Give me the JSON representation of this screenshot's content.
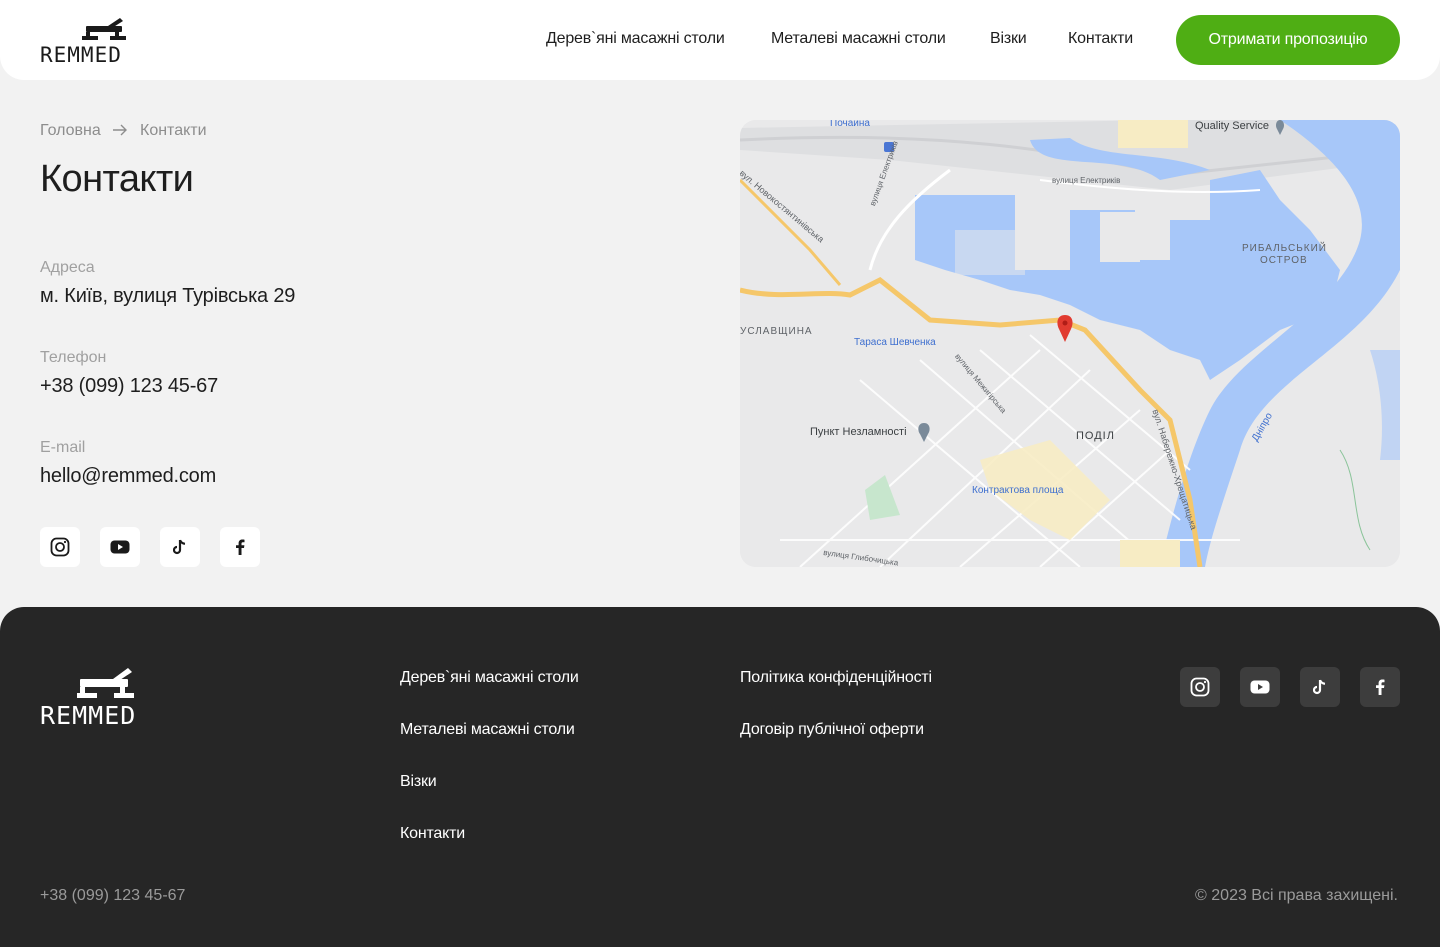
{
  "header": {
    "logo_text": "REMMED",
    "nav": [
      "Дерев`яні масажні столи",
      "Металеві масажні столи",
      "Візки",
      "Контакти"
    ],
    "cta": "Отримати пропозицію"
  },
  "breadcrumb": {
    "home": "Головна",
    "current": "Контакти"
  },
  "page_title": "Контакти",
  "contacts": {
    "address_label": "Адреса",
    "address": "м. Київ, вулиця Турівська 29",
    "phone_label": "Телефон",
    "phone": "+38 (099) 123 45-67",
    "email_label": "E-mail",
    "email": "hello@remmed.com"
  },
  "socials": [
    "instagram-icon",
    "youtube-icon",
    "tiktok-icon",
    "facebook-icon"
  ],
  "map": {
    "labels": {
      "pochaina": "Почайна",
      "quality": "Quality Service",
      "elektrykiv1": "вулиця Електриків",
      "elektrykiv2": "вулиця Електриків",
      "novokost": "вул. Новокостянтинівська",
      "rybalskyi1": "РИБАЛЬСЬКИЙ",
      "rybalskyi2": "ОСТРОВ",
      "uslavshchyna": "УСЛАВЩИНА",
      "shevchenka": "Тараса Шевченка",
      "mezhyhirska": "вулиця Межигірська",
      "nezalezhnosti": "Пункт Незламності",
      "podil": "ПОДІЛ",
      "naberezhno": "вул. Набережно-Хрещатицька",
      "dnipro": "Дніпро",
      "kontraktova": "Контрактова площа",
      "hlybochytska": "вулиця Глибочицька"
    }
  },
  "footer": {
    "logo_text": "REMMED",
    "links_col1": [
      "Дерев`яні масажні столи",
      "Металеві масажні столи",
      "Візки",
      "Контакти"
    ],
    "links_col2": [
      "Політика конфіденційності",
      "Договір публічної оферти"
    ],
    "phone": "+38 (099) 123 45-67",
    "copyright": "© 2023 Всі права захищені."
  },
  "colors": {
    "accent": "#4fae14",
    "footer_bg": "#262626",
    "page_bg": "#f2f2f2",
    "water": "#a7c7f9",
    "road": "#f5c76a"
  }
}
